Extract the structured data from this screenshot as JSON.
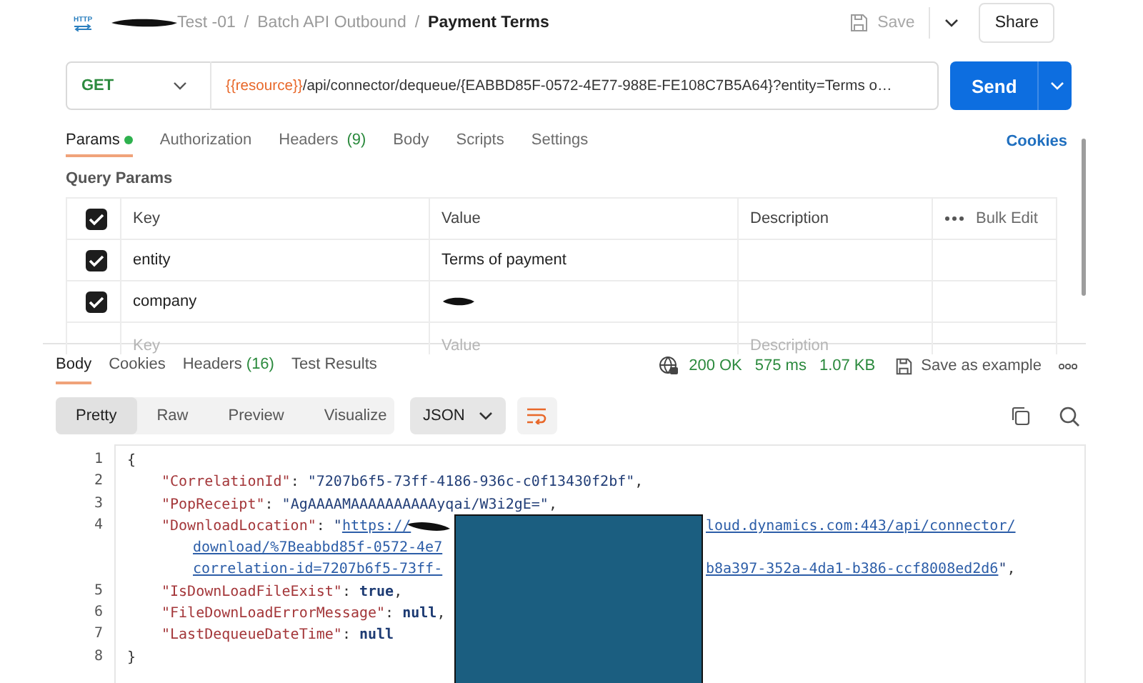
{
  "header": {
    "icon_label": "HTTP",
    "separator": "/",
    "breadcrumb": [
      {
        "text": "Test -01",
        "redacted": true
      },
      {
        "text": "Batch API Outbound"
      },
      {
        "text": "Payment Terms"
      }
    ],
    "save": {
      "label": "Save",
      "disabled": true
    },
    "share": "Share"
  },
  "request": {
    "method": "GET",
    "url_variable": "{{resource}}",
    "url_rest": "/api/connector/dequeue/{EABBD85F-0572-4E77-988E-FE108C7B5A64}?entity=Terms o…",
    "send": "Send"
  },
  "request_tabs": [
    {
      "label": "Params",
      "indicator": true,
      "selected": true
    },
    {
      "label": "Authorization",
      "indicator": false,
      "selected": false
    },
    {
      "label": "Headers",
      "count": "(9)",
      "indicator": false,
      "selected": false
    },
    {
      "label": "Body",
      "indicator": false,
      "selected": false
    },
    {
      "label": "Scripts",
      "indicator": false,
      "selected": false
    },
    {
      "label": "Settings",
      "indicator": false,
      "selected": false
    }
  ],
  "cookies": "Cookies",
  "query_params": {
    "title": "Query Params",
    "columns": [
      "Key",
      "Value",
      "Description"
    ],
    "bulk_edit": "Bulk Edit",
    "header_checked": true,
    "rows": [
      {
        "checked": true,
        "key": "entity",
        "value": "Terms of payment"
      },
      {
        "checked": true,
        "key": "company",
        "redacted": true
      }
    ],
    "placeholder": {
      "key": "Key",
      "value": "Value",
      "description": "Description"
    }
  },
  "response": {
    "tabs": [
      {
        "label": "Body",
        "selected": true
      },
      {
        "label": "Cookies",
        "selected": false
      },
      {
        "label": "Headers",
        "count": "(16)",
        "selected": false
      },
      {
        "label": "Test Results",
        "selected": false
      }
    ],
    "status": "200 OK",
    "time": "575 ms",
    "size": "1.07 KB",
    "save_example": "Save as example",
    "views": [
      {
        "label": "Pretty",
        "selected": true
      },
      {
        "label": "Raw",
        "selected": false
      },
      {
        "label": "Preview",
        "selected": false
      },
      {
        "label": "Visualize",
        "selected": false
      }
    ],
    "format": "JSON",
    "wrap_on": true,
    "lines": [
      {
        "number": "1",
        "rows": [
          {
            "kind": "brace",
            "segments": [
              {
                "kind": "punct",
                "text": "{"
              }
            ]
          }
        ]
      },
      {
        "number": "2",
        "rows": [
          {
            "kind": "member",
            "segments": [
              {
                "kind": "key",
                "text": "\"CorrelationId\""
              },
              {
                "kind": "punct",
                "text": ": "
              },
              {
                "kind": "string",
                "text": "\"7207b6f5-73ff-4186-936c-c0f13430f2bf\""
              },
              {
                "kind": "punct",
                "text": ","
              }
            ]
          }
        ]
      },
      {
        "number": "3",
        "rows": [
          {
            "kind": "member",
            "segments": [
              {
                "kind": "key",
                "text": "\"PopReceipt\""
              },
              {
                "kind": "punct",
                "text": ": "
              },
              {
                "kind": "string",
                "text": "\"AgAAAAMAAAAAAAAAAyqai/W3i2gE=\""
              },
              {
                "kind": "punct",
                "text": ","
              }
            ]
          }
        ]
      },
      {
        "number": "4",
        "rows": [
          {
            "kind": "member",
            "scribble": true,
            "segments": [
              {
                "kind": "key",
                "text": "\"DownloadLocation\""
              },
              {
                "kind": "punct",
                "text": ": "
              },
              {
                "kind": "string",
                "text": "\""
              },
              {
                "kind": "link",
                "text": "https://"
              }
            ],
            "after": [
              {
                "kind": "link",
                "text": "loud.dynamics.com:443/api/connector/"
              }
            ]
          },
          {
            "kind": "continuation",
            "segments": [
              {
                "kind": "link",
                "text": "download/%7Beabbd85f-0572-4e7"
              }
            ]
          },
          {
            "kind": "continuation",
            "segments": [
              {
                "kind": "link",
                "text": "correlation-id=7207b6f5-73ff-"
              }
            ],
            "after": [
              {
                "kind": "link",
                "text": "b8a397-352a-4da1-b386-ccf8008ed2d6"
              },
              {
                "kind": "string",
                "text": "\""
              },
              {
                "kind": "punct",
                "text": ","
              }
            ]
          }
        ]
      },
      {
        "number": "5",
        "rows": [
          {
            "kind": "member",
            "segments": [
              {
                "kind": "key",
                "text": "\"IsDownLoadFileExist\""
              },
              {
                "kind": "punct",
                "text": ": "
              },
              {
                "kind": "literal",
                "text": "true"
              },
              {
                "kind": "punct",
                "text": ","
              }
            ]
          }
        ]
      },
      {
        "number": "6",
        "rows": [
          {
            "kind": "member",
            "segments": [
              {
                "kind": "key",
                "text": "\"FileDownLoadErrorMessage\""
              },
              {
                "kind": "punct",
                "text": ": "
              },
              {
                "kind": "literal",
                "text": "null"
              },
              {
                "kind": "punct",
                "text": ","
              }
            ]
          }
        ]
      },
      {
        "number": "7",
        "rows": [
          {
            "kind": "member",
            "segments": [
              {
                "kind": "key",
                "text": "\"LastDequeueDateTime\""
              },
              {
                "kind": "punct",
                "text": ": "
              },
              {
                "kind": "literal",
                "text": "null"
              }
            ]
          }
        ]
      },
      {
        "number": "8",
        "rows": [
          {
            "kind": "brace",
            "segments": [
              {
                "kind": "punct",
                "text": "}"
              }
            ]
          }
        ]
      }
    ]
  }
}
